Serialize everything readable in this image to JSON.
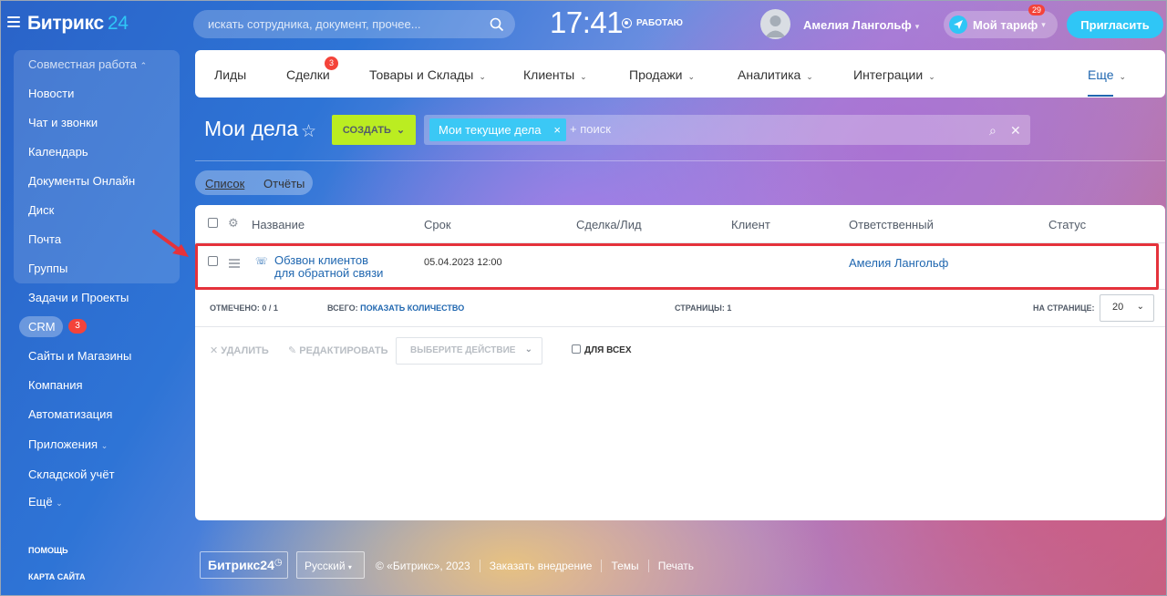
{
  "header": {
    "logo_text": "Битрикс",
    "logo_num": "24",
    "search_placeholder": "искать сотрудника, документ, прочее...",
    "clock": "17:41",
    "work_status": "РАБОТАЮ",
    "user_name": "Амелия Лангольф",
    "tariff_label": "Мой тариф",
    "tariff_badge": "29",
    "invite_label": "Пригласить"
  },
  "sidebar": {
    "group_title": "Совместная работа",
    "group_items": [
      "Новости",
      "Чат и звонки",
      "Календарь",
      "Документы Онлайн",
      "Диск",
      "Почта",
      "Группы"
    ],
    "items": [
      "Задачи и Проекты",
      "CRM",
      "Сайты и Магазины",
      "Компания",
      "Автоматизация",
      "Приложения",
      "Складской учёт",
      "Ещё"
    ],
    "crm_badge": "3",
    "help": "ПОМОЩЬ",
    "sitemap": "КАРТА САЙТА"
  },
  "topnav": {
    "items": [
      "Лиды",
      "Сделки",
      "Товары и Склады",
      "Клиенты",
      "Продажи",
      "Аналитика",
      "Интеграции",
      "Еще"
    ],
    "deals_badge": "3",
    "active": "Еще"
  },
  "page": {
    "title": "Мои дела",
    "create_label": "СОЗДАТЬ",
    "filter_tag": "Мои текущие дела",
    "filter_placeholder": "+ поиск",
    "view_list": "Список",
    "view_reports": "Отчёты"
  },
  "grid": {
    "columns": [
      "Название",
      "Срок",
      "Сделка/Лид",
      "Клиент",
      "Ответственный",
      "Статус"
    ],
    "rows": [
      {
        "title_line1": "Обзвон клиентов",
        "title_line2": "для обратной связи",
        "deadline": "05.04.2023 12:00",
        "deal": "",
        "client": "",
        "responsible": "Амелия Лангольф",
        "status": ""
      }
    ],
    "marked_label": "ОТМЕЧЕНО:",
    "marked_value": "0 / 1",
    "total_label": "ВСЕГО:",
    "total_link": "ПОКАЗАТЬ КОЛИЧЕСТВО",
    "pages_label": "СТРАНИЦЫ:",
    "pages_value": "1",
    "per_page_label": "НА СТРАНИЦЕ:",
    "per_page_value": "20",
    "delete_label": "УДАЛИТЬ",
    "edit_label": "РЕДАКТИРОВАТЬ",
    "action_select": "ВЫБЕРИТЕ ДЕЙСТВИЕ",
    "for_all_label": "ДЛЯ ВСЕХ"
  },
  "footer": {
    "brand": "Битрикс24",
    "language": "Русский",
    "copyright": "© «Битрикс», 2023",
    "links": [
      "Заказать внедрение",
      "Темы",
      "Печать"
    ]
  },
  "colors": {
    "accent": "#2fc6f6",
    "create_button": "#bbed21",
    "link": "#2067b0",
    "badge": "#f4433a",
    "highlight_box": "#e5323b"
  }
}
